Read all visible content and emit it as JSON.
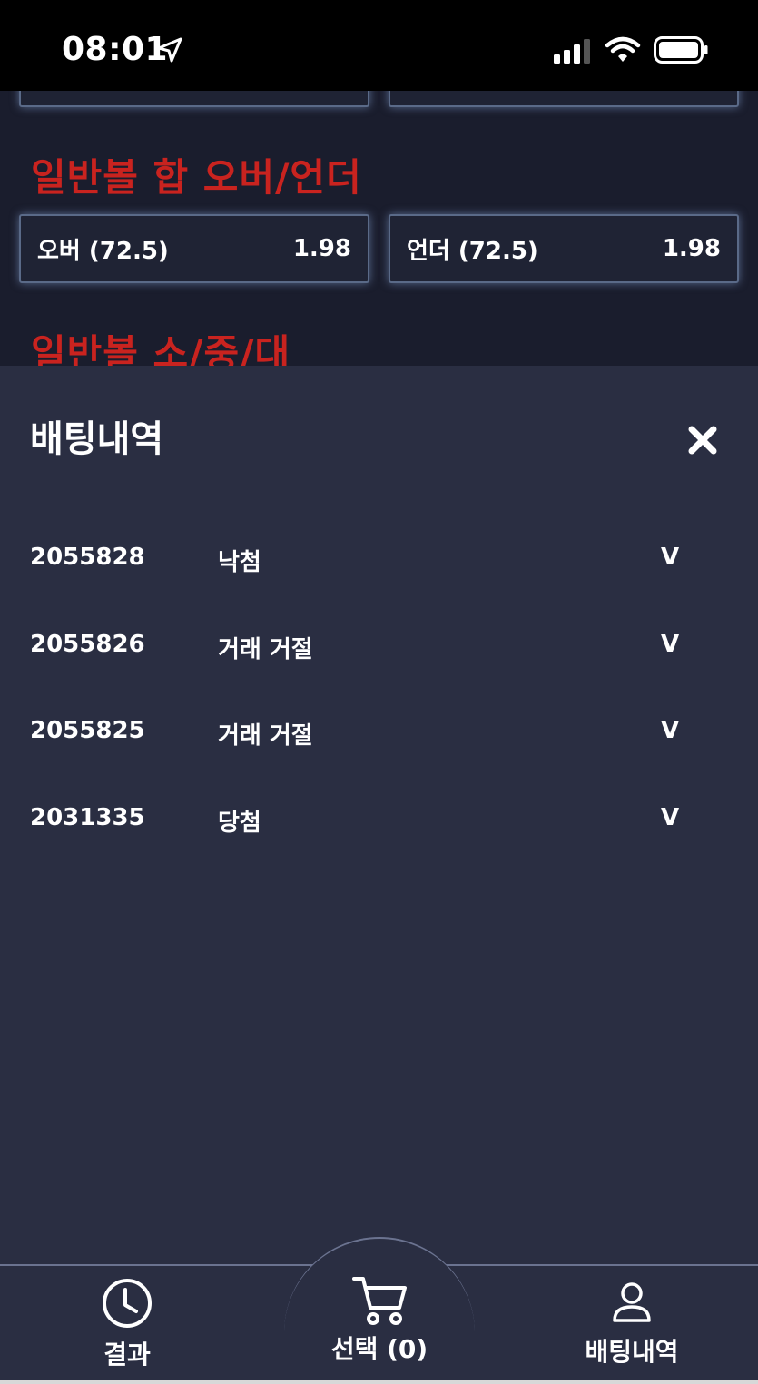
{
  "status_bar": {
    "time": "08:01"
  },
  "background_page": {
    "section_over_under": {
      "title": "일반볼 합 오버/언더",
      "options": [
        {
          "label": "오버 (72.5)",
          "odds": "1.98"
        },
        {
          "label": "언더 (72.5)",
          "odds": "1.98"
        }
      ]
    },
    "section_size": {
      "title": "일반볼 소/중/대"
    }
  },
  "history_sheet": {
    "title": "배팅내역",
    "rows": [
      {
        "id": "2055828",
        "status": "낙첨",
        "toggle": "V"
      },
      {
        "id": "2055826",
        "status": "거래 거절",
        "toggle": "V"
      },
      {
        "id": "2055825",
        "status": "거래 거절",
        "toggle": "V"
      },
      {
        "id": "2031335",
        "status": "당첨",
        "toggle": "V"
      }
    ]
  },
  "tab_bar": {
    "results_label": "결과",
    "cart_label": "선택 (0)",
    "history_label": "배팅내역",
    "icons": {
      "results": "clock-icon",
      "cart": "cart-icon",
      "history": "user-icon"
    }
  },
  "colors": {
    "accent_red": "#c9231f",
    "sheet_bg": "#2a2e42",
    "page_bg": "#1a1d2d"
  }
}
